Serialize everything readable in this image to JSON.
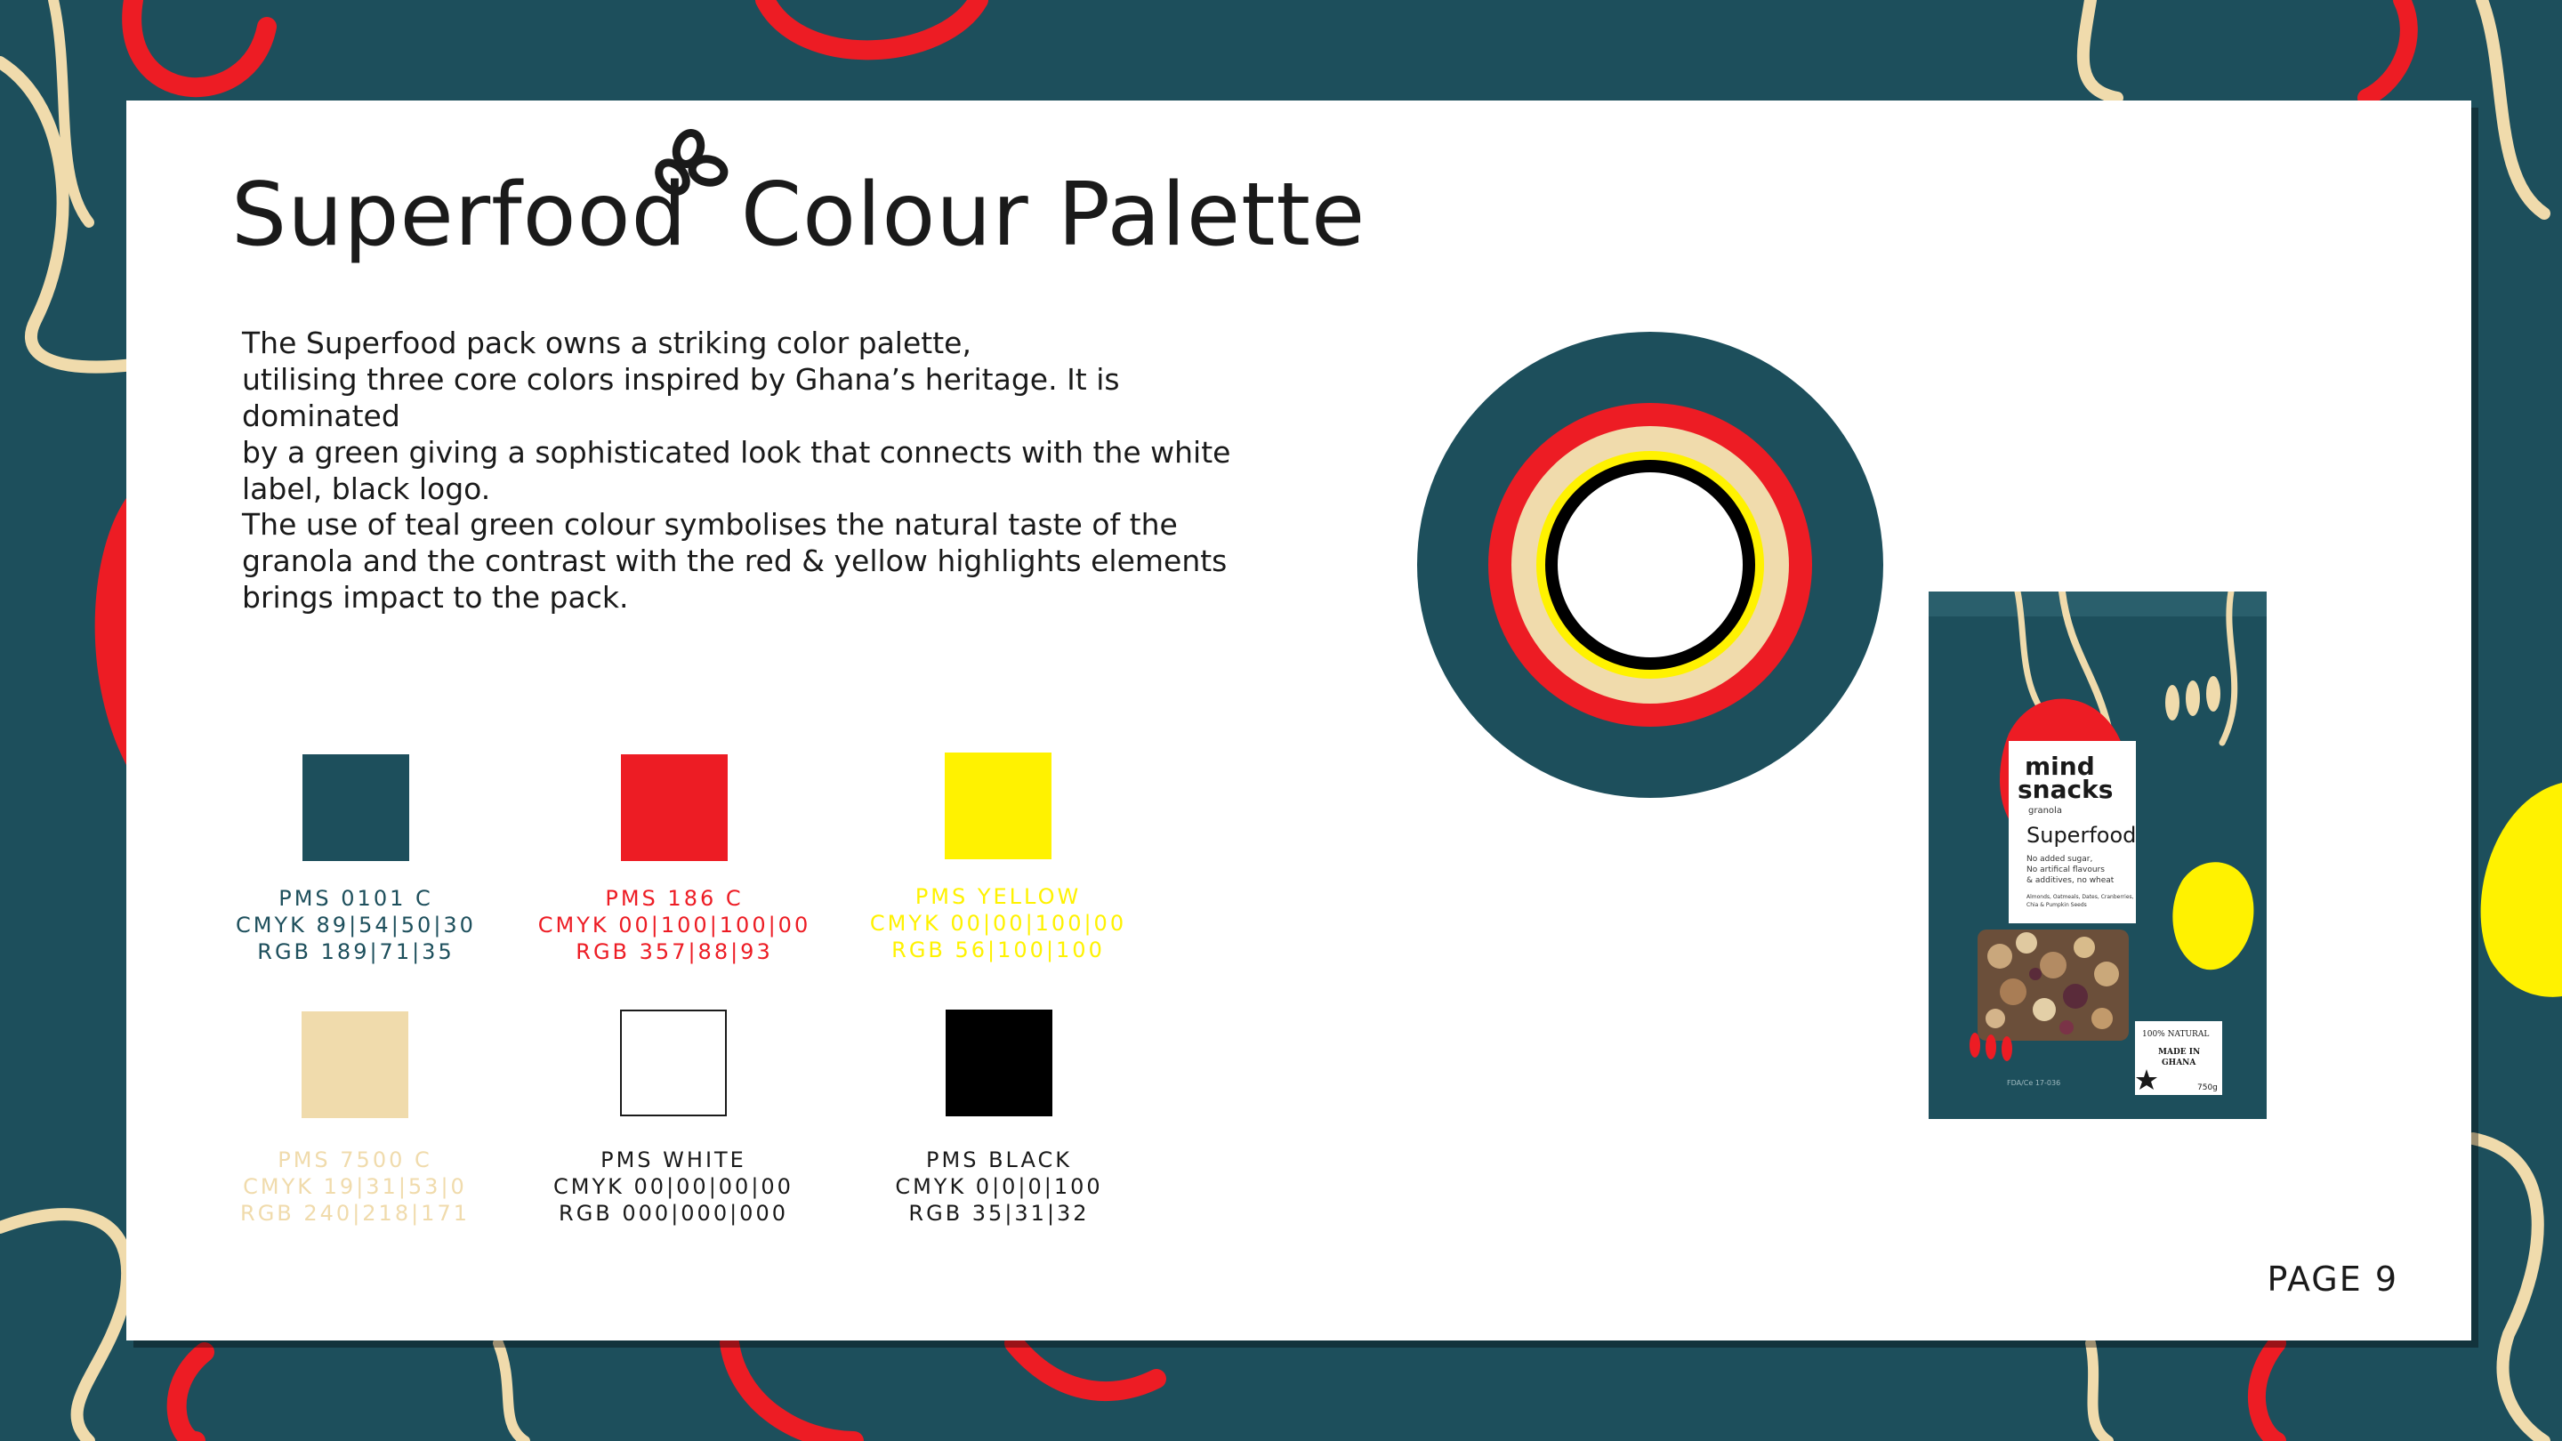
{
  "page": {
    "title_left": "Superfood",
    "title_right": "Colour Palette",
    "paragraph_1": [
      "The Superfood pack owns a striking color palette,",
      "utilising three core colors inspired by Ghana’s heritage. It is dominated",
      "by a green giving a sophisticated look that connects with the white",
      "label, black logo."
    ],
    "paragraph_2": [
      "The use of teal green colour symbolises the natural taste of the",
      "granola and the contrast with the red & yellow highlights elements",
      "brings impact to the pack."
    ],
    "page_number": "PAGE 9"
  },
  "colors": {
    "teal": "#1d4f5c",
    "red": "#ed1c24",
    "yellow": "#fff200",
    "cream": "#f0dbac",
    "white": "#ffffff",
    "black": "#000000"
  },
  "swatches": [
    {
      "name": "PMS 0101 C",
      "cmyk": "CMYK 89|54|50|30",
      "rgb": "RGB 189|71|35",
      "color": "#1d4f5c",
      "text_color": "#1d4f5c"
    },
    {
      "name": "PMS 186 C",
      "cmyk": "CMYK 00|100|100|00",
      "rgb": "RGB 357|88|93",
      "color": "#ed1c24",
      "text_color": "#ed1c24"
    },
    {
      "name": "PMS YELLOW",
      "cmyk": "CMYK 00|00|100|00",
      "rgb": "RGB 56|100|100",
      "color": "#fff200",
      "text_color": "#fff200"
    },
    {
      "name": "PMS 7500 C",
      "cmyk": "CMYK 19|31|53|0",
      "rgb": "RGB 240|218|171",
      "color": "#f0dbac",
      "text_color": "#f0dbac"
    },
    {
      "name": "PMS WHITE",
      "cmyk": "CMYK 00|00|00|00",
      "rgb": "RGB 000|000|000",
      "color": "#ffffff",
      "text_color": "#1a1a1a"
    },
    {
      "name": "PMS BLACK",
      "cmyk": "CMYK 0|0|0|100",
      "rgb": "RGB 35|31|32",
      "color": "#000000",
      "text_color": "#1a1a1a"
    }
  ],
  "package": {
    "brand_line_1": "mind",
    "brand_line_2": "snacks",
    "category": "granola",
    "product": "Superfood",
    "claims": [
      "No added sugar,",
      "No artifical flavours",
      "& additives, no wheat"
    ],
    "ingredients": [
      "Almonds, Oatmeals, Dates, Cranberries,",
      "Chia & Pumpkin Seeds"
    ],
    "badge": [
      "100% NATURAL",
      "MADE IN",
      "GHANA"
    ],
    "weight": "750g",
    "fda": "FDA/Ce 17-036"
  },
  "icons": {
    "title_icon": "clover-icon",
    "badge_icon": "star-icon"
  }
}
